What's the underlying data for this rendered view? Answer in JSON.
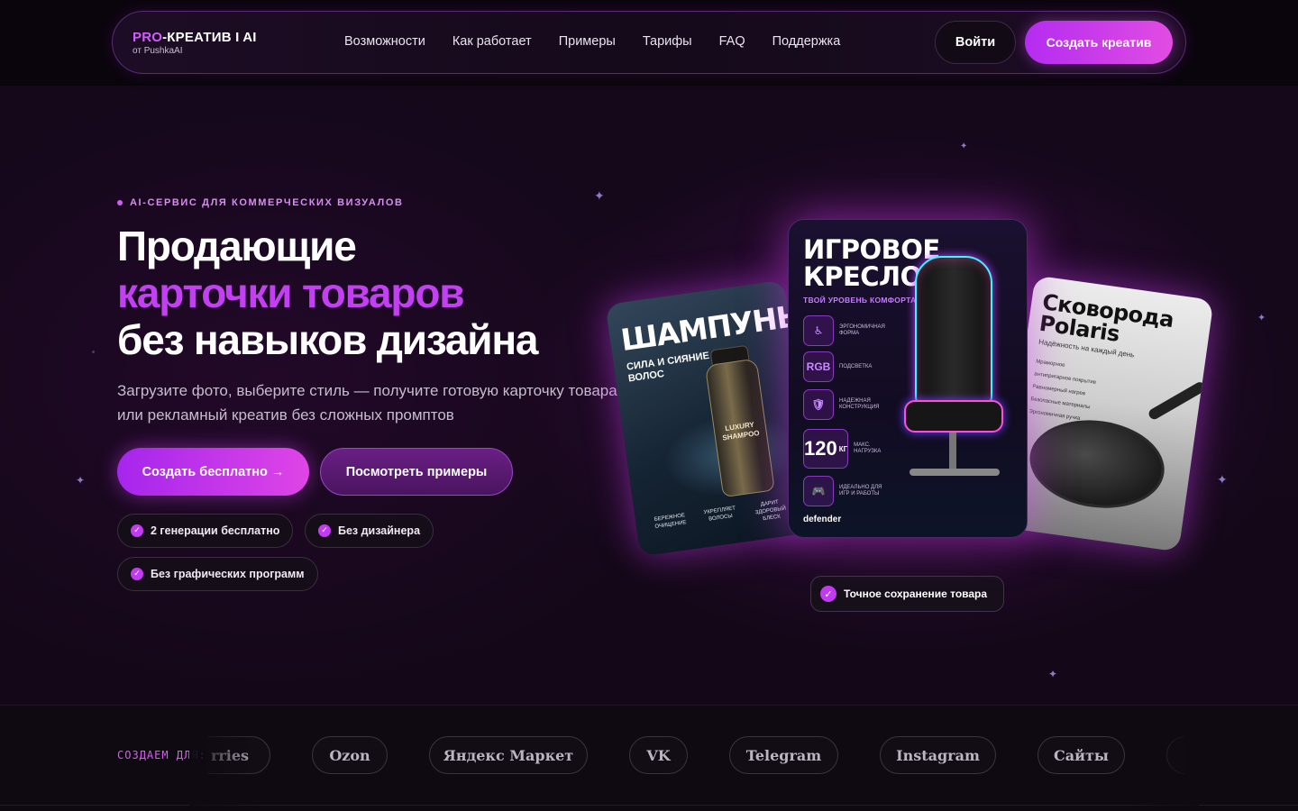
{
  "brand": {
    "logo_pro": "PRO",
    "logo_rest": "-КРЕАТИВ I AI",
    "logo_sub": "от PushkaAI"
  },
  "nav": {
    "items": [
      "Возможности",
      "Как работает",
      "Примеры",
      "Тарифы",
      "FAQ",
      "Поддержка"
    ],
    "login": "Войти",
    "create": "Создать креатив"
  },
  "hero": {
    "eyebrow": "AI-СЕРВИС ДЛЯ КОММЕРЧЕСКИХ ВИЗУАЛОВ",
    "headline_line1": "Продающие",
    "headline_line2": "карточки товаров",
    "headline_line3": "без навыков дизайна",
    "subtitle": "Загрузите фото, выберите стиль — получите готовую карточку товара или рекламный креатив без сложных промптов",
    "cta_primary": "Создать бесплатно →",
    "cta_secondary": "Посмотреть примеры",
    "chips": [
      "2 генерации бесплатно",
      "Без дизайнера",
      "Без графических программ"
    ]
  },
  "cards": {
    "shampoo": {
      "title": "ШАМПУНЬ",
      "subtitle": "СИЛА И СИЯНИЕ ВОЛОС",
      "bottle_label": "LUXURY SHAMPOO",
      "badges": [
        "БЕРЕЖНОЕ ОЧИЩЕНИЕ",
        "УКРЕПЛЯЕТ ВОЛОСЫ",
        "ДАРИТ ЗДОРОВЫЙ БЛЕСК"
      ]
    },
    "chair": {
      "title_line1": "ИГРОВОЕ",
      "title_line2": "КРЕСЛО",
      "subtitle": "ТВОЙ УРОВЕНЬ КОМФОРТА",
      "features": [
        {
          "icon": "♿",
          "caption": "ЭРГОНОМИЧНАЯ ФОРМА"
        },
        {
          "icon": "RGB",
          "caption": "ПОДСВЕТКА"
        },
        {
          "icon": "🛡",
          "caption": "НАДЕЖНАЯ КОНСТРУКЦИЯ"
        },
        {
          "icon": "120",
          "unit": "КГ",
          "caption": "МАКС. НАГРУЗКА"
        },
        {
          "icon": "🎮",
          "caption": "ИДЕАЛЬНО ДЛЯ ИГР И РАБОТЫ"
        }
      ],
      "brand": "defender"
    },
    "pan": {
      "title_line1": "Сковорода",
      "title_line2": "Polaris",
      "subtitle": "Надёжность на каждый день",
      "features": [
        "Мраморное антипригарное покрытие",
        "Равномерный нагрев",
        "Безопасные материалы",
        "Эргономичная ручка"
      ]
    }
  },
  "badge_precision": "Точное сохранение товара",
  "platforms": {
    "label": "СОЗДАЕМ ДЛЯ:",
    "partial_left": "rries",
    "items": [
      "Ozon",
      "Яндекс Маркет",
      "VK",
      "Telegram",
      "Instagram",
      "Сайты"
    ]
  },
  "colors": {
    "accent": "#c240f2",
    "accent_gradient_start": "#a526ec",
    "accent_gradient_end": "#df45e6",
    "background": "#140818"
  }
}
